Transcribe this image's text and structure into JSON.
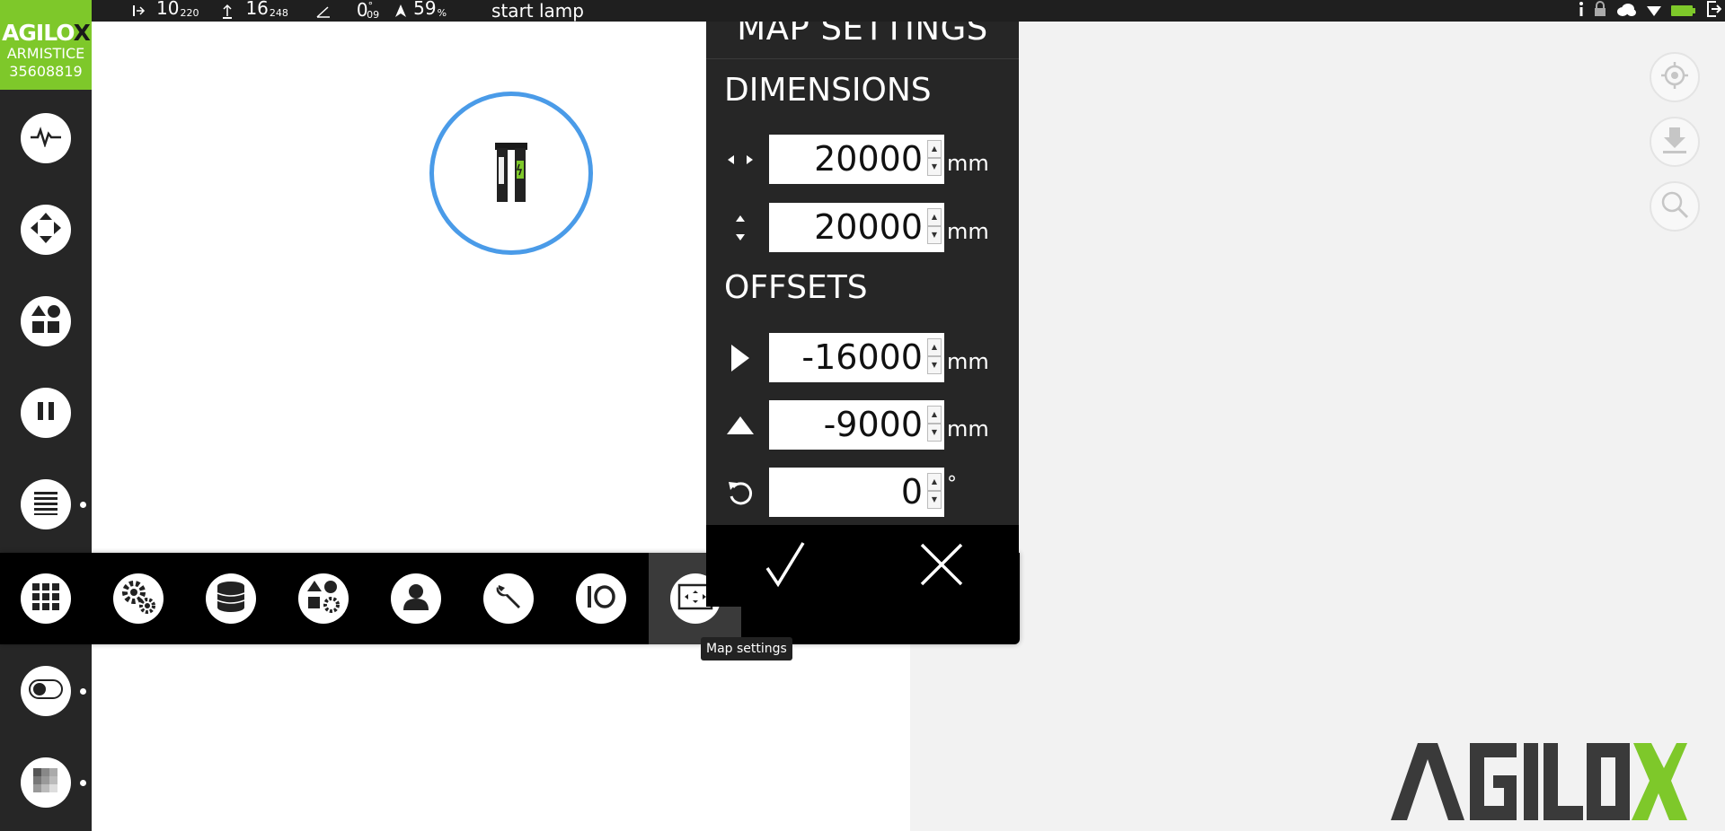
{
  "status": {
    "x": "10",
    "x_sub": "220",
    "y": "16",
    "y_sub": "248",
    "angle": "0",
    "angle_sup": "°",
    "angle_sub": "09",
    "battery": "59",
    "battery_unit": "%",
    "message": "start lamp"
  },
  "logo": {
    "brand": "AGILO",
    "brand_x": "X",
    "robot_name": "ARMISTICE",
    "robot_id": "35608819"
  },
  "sidebar_icons": [
    "pulse-icon",
    "move-arrows-icon",
    "workflow-icon",
    "pause-icon",
    "list-icon",
    "toggle-icon",
    "layers-icon"
  ],
  "toolbar_icons": [
    "grid-icon",
    "gears-icon",
    "database-icon",
    "shapes-gear-icon",
    "user-icon",
    "wrench-icon",
    "io-icon",
    "map-settings-icon"
  ],
  "tooltip": "Map settings",
  "map_settings": {
    "title": "MAP SETTINGS",
    "dimensions_label": "DIMENSIONS",
    "width": "20000",
    "height": "20000",
    "offsets_label": "OFFSETS",
    "offset_x": "-16000",
    "offset_y": "-9000",
    "rotation": "0",
    "unit_mm": "mm",
    "unit_deg": "°"
  },
  "right_tools": [
    "locate-icon",
    "download-icon",
    "search-icon"
  ],
  "brand_watermark": "AGILOX"
}
